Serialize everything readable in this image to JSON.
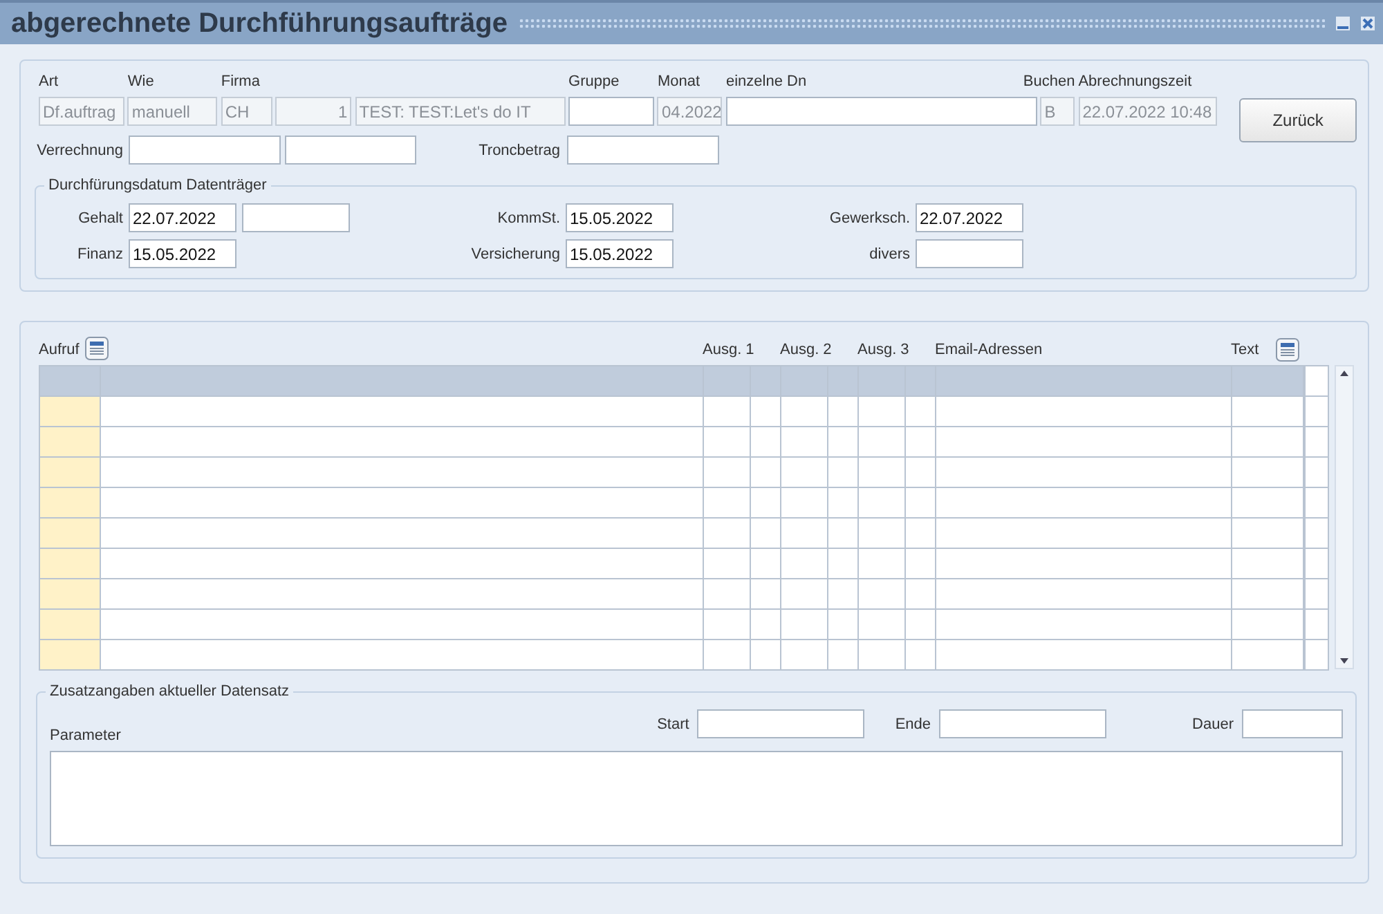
{
  "window": {
    "title": "abgerechnete Durchführungsaufträge"
  },
  "header_fields": [
    {
      "label": "Art",
      "value": "Df.auftrag",
      "disabled": true
    },
    {
      "label": "Wie",
      "value": "manuell",
      "disabled": true
    },
    {
      "label": "Firma",
      "value": "CH",
      "disabled": true
    },
    {
      "value": "1",
      "disabled": true,
      "kind": "number"
    },
    {
      "value": "TEST: TEST:Let's do IT",
      "disabled": true
    },
    {
      "label": "Gruppe",
      "disabled": false
    },
    {
      "label": "Monat",
      "value": "04.2022",
      "disabled": true
    },
    {
      "label": "einzelne Dn",
      "disabled": false
    },
    {
      "label": "Buchen",
      "value": "B",
      "disabled": true
    },
    {
      "label": "Abrechnungszeit",
      "value": "22.07.2022 10:48",
      "disabled": true
    }
  ],
  "back_button": "Zurück",
  "verrechnung_label": "Verrechnung",
  "troncbetrag_label": "Troncbetrag",
  "dates": {
    "title": "Durchfürungsdatum Datenträger",
    "rows": [
      [
        {
          "label": "Gehalt",
          "value": "22.07.2022"
        },
        {
          "kind": "field"
        },
        {
          "label": "KommSt.",
          "value": "15.05.2022"
        },
        {
          "label": "Gewerksch.",
          "value": "22.07.2022"
        }
      ],
      [
        {
          "label": "Finanz",
          "value": "15.05.2022"
        },
        {
          "kind": "blank"
        },
        {
          "label": "Versicherung",
          "value": "15.05.2022"
        },
        {
          "label": "divers"
        }
      ]
    ]
  },
  "table": {
    "columns": [
      "Aufruf",
      "Ausg. 1",
      "Ausg. 2",
      "Ausg. 3",
      "Email-Adressen",
      "Text"
    ],
    "rows": [
      {
        "selected": true
      },
      {
        "selected": false
      },
      {
        "selected": false
      },
      {
        "selected": false
      },
      {
        "selected": false
      },
      {
        "selected": false
      },
      {
        "selected": false
      },
      {
        "selected": false
      },
      {
        "selected": false
      },
      {
        "selected": false
      }
    ]
  },
  "details": {
    "title": "Zusatzangaben aktueller Datensatz",
    "parameter_label": "Parameter",
    "fields": [
      "Start",
      "Ende",
      "Dauer"
    ]
  }
}
